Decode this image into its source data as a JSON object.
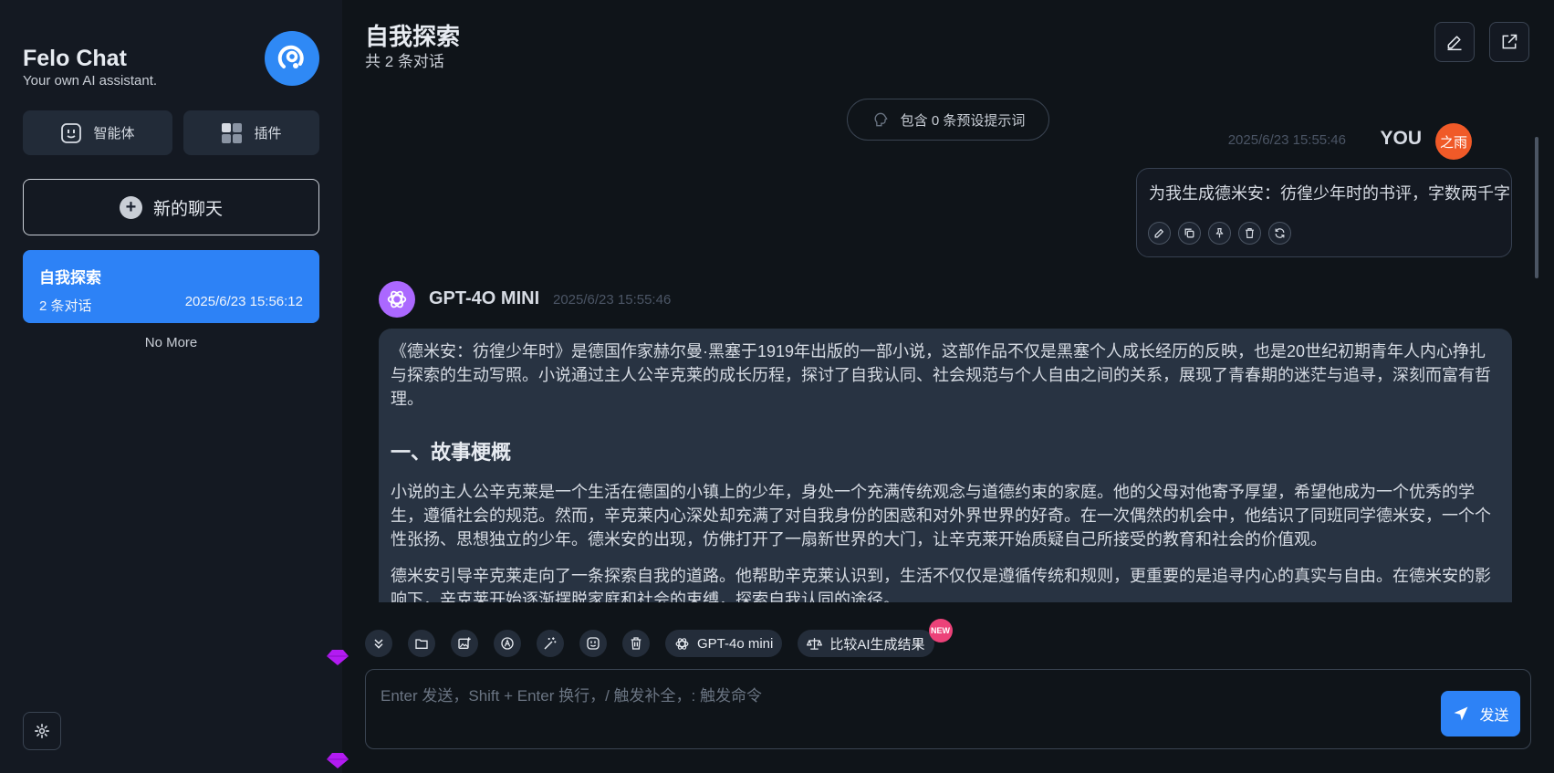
{
  "sidebar": {
    "brand_title": "Felo Chat",
    "brand_subtitle": "Your own AI assistant.",
    "agent_label": "智能体",
    "plugin_label": "插件",
    "new_chat_label": "新的聊天",
    "chats": [
      {
        "title": "自我探索",
        "count": "2 条对话",
        "date": "2025/6/23 15:56:12"
      }
    ],
    "no_more": "No More"
  },
  "header": {
    "title": "自我探索",
    "subtitle": "共 2 条对话"
  },
  "prompt_pill": "包含 0 条预设提示词",
  "messages": {
    "user": {
      "time": "2025/6/23 15:55:46",
      "name": "YOU",
      "avatar_text": "之雨",
      "text": "为我生成德米安：彷徨少年时的书评，字数两千字"
    },
    "bot": {
      "name": "GPT-4O MINI",
      "time": "2025/6/23 15:55:46",
      "para1": "《德米安：彷徨少年时》是德国作家赫尔曼·黑塞于1919年出版的一部小说，这部作品不仅是黑塞个人成长经历的反映，也是20世纪初期青年人内心挣扎与探索的生动写照。小说通过主人公辛克莱的成长历程，探讨了自我认同、社会规范与个人自由之间的关系，展现了青春期的迷茫与追寻，深刻而富有哲理。",
      "heading1": "一、故事梗概",
      "para2": "小说的主人公辛克莱是一个生活在德国的小镇上的少年，身处一个充满传统观念与道德约束的家庭。他的父母对他寄予厚望，希望他成为一个优秀的学生，遵循社会的规范。然而，辛克莱内心深处却充满了对自我身份的困惑和对外界世界的好奇。在一次偶然的机会中，他结识了同班同学德米安，一个个性张扬、思想独立的少年。德米安的出现，仿佛打开了一扇新世界的大门，让辛克莱开始质疑自己所接受的教育和社会的价值观。",
      "para3": "德米安引导辛克莱走向了一条探索自我的道路。他帮助辛克莱认识到，生活不仅仅是遵循传统和规则，更重要的是追寻内心的真实与自由。在德米安的影响下，辛克莱开始逐渐摆脱家庭和社会的束缚，探索自我认同的途径。"
    }
  },
  "toolbar": {
    "model_label": "GPT-4o mini",
    "compare_label": "比较AI生成结果",
    "new_badge": "NEW"
  },
  "input": {
    "placeholder": "Enter 发送，Shift + Enter 换行，/ 触发补全，: 触发命令",
    "send_label": "发送"
  },
  "colors": {
    "accent": "#2d82f6",
    "background": "#0f1419",
    "sidebar": "#141922",
    "bot_bubble": "#283342",
    "user_avatar": "#f05a28",
    "bot_avatar": "#ab68ff",
    "new_badge": "#ec4279"
  }
}
